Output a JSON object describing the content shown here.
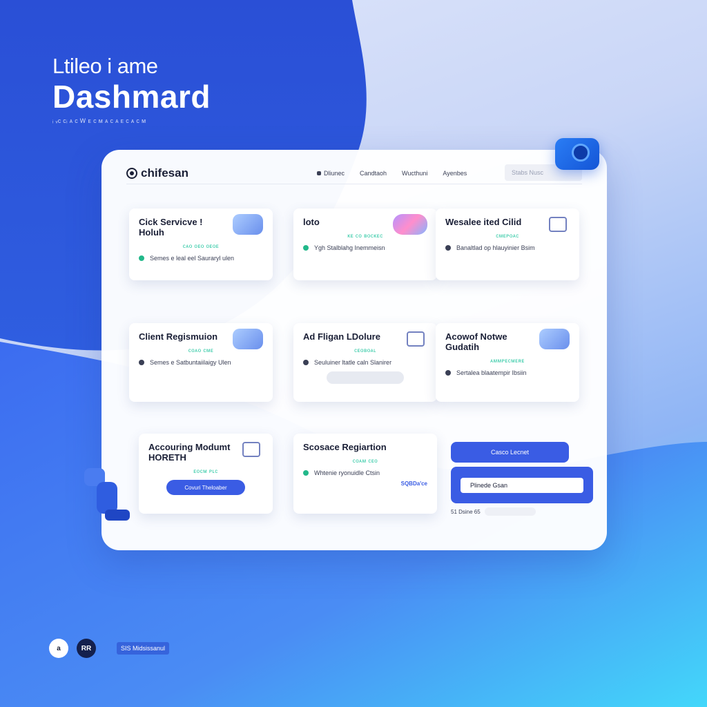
{
  "hero": {
    "subtitle": "Ltileo i ame",
    "title": "Dashmard",
    "caption": "ᵢ ᵥᴄ ᴄᵢ ᴀ ᴄ Ꮃ ᴇ ᴄ ᴍ ᴀ ᴄ ᴀ ᴇ ᴄ ᴀ ᴄ ᴍ"
  },
  "topbar": {
    "logo": "chifesan",
    "nav": [
      "Dliunec",
      "Candtaoh",
      "Wucthuni",
      "Ayenbes"
    ],
    "search_placeholder": "Stabs Nusc"
  },
  "cards": [
    {
      "title": "Cick Servicve ! Holuh",
      "tag": "ᴄᴀᴏ ᴏᴇᴏ ᴏᴇᴏᴇ",
      "row": "Semes e leal eel Sauraryl ulen",
      "art": "blob"
    },
    {
      "title": "loto",
      "tag": "ᴋᴇ ᴄᴏ ʙᴏᴄᴋᴇᴄ",
      "row": "Ygh Stalblahg Inemmeisn",
      "art": "heart"
    },
    {
      "title": "Wesalee ited Cilid",
      "tag": "ᴄᴍᴇᴘᴏᴀᴄ",
      "row": "Banaltlad op hlauyinier Bsim",
      "art": "line"
    },
    {
      "title": "Client Regismuion",
      "tag": "ᴄᴏᴀᴏ ᴄᴍᴇ",
      "row": "Semes e Satbuntaiilaigy Ulen",
      "art": "blob"
    },
    {
      "title": "Ad Fligan LDolure",
      "tag": "ᴄᴇᴏʙᴏᴀʟ",
      "row": "Seuluiner ltatle caln Slanirer",
      "art": "line"
    },
    {
      "title": "Acowof Notwe Gudatih",
      "tag": "ᴀᴍᴍᴘᴇᴄᴍᴇʀᴇ",
      "row": "Sertalea blaatempir Ibsiin",
      "art": "blob"
    },
    {
      "title": "Accouring Modumt HORETH",
      "tag": "ᴇᴏᴄᴍ ᴘʟᴄ",
      "button": "Covuri Theloaber"
    },
    {
      "title": "Scosace Regiartion",
      "tag": "ᴄᴏᴀᴍ ᴄᴇᴏ",
      "row": "Whtenie ryonuidle Ctsin",
      "foot": "SQBDa'ce"
    }
  ],
  "right_panel": {
    "primary_button": "Casco Lecnet",
    "input_value": "Plinede Gsan",
    "footer_label": "51 Dsine 65"
  },
  "bottom": {
    "circle1": "a",
    "circle2": "RR",
    "tag": "SIS Midsissanul"
  },
  "colors": {
    "brand_blue": "#3a5ce4",
    "deep_blue": "#2545c9",
    "accent_teal": "#26c6a0"
  }
}
